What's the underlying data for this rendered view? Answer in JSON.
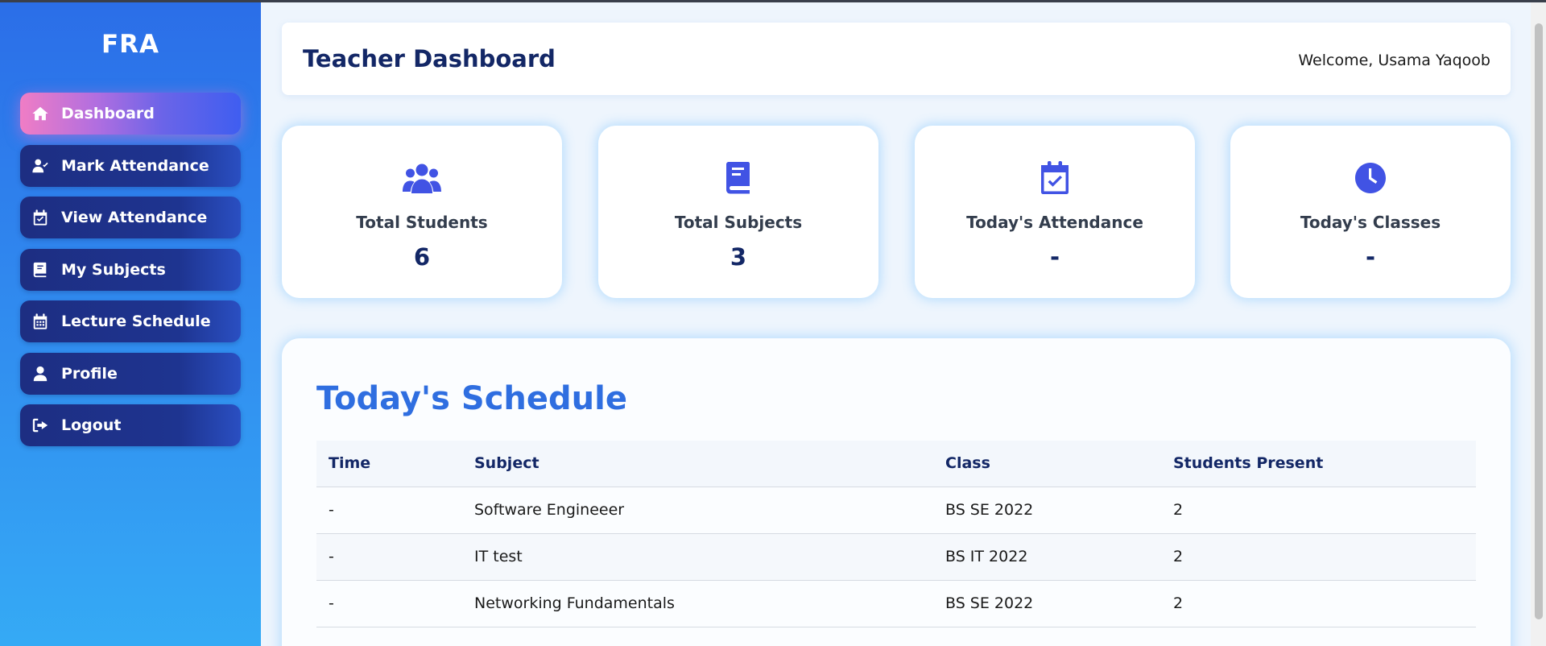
{
  "brand": "FRA",
  "sidebar": {
    "items": [
      {
        "label": "Dashboard",
        "icon": "home-icon",
        "active": true
      },
      {
        "label": "Mark Attendance",
        "icon": "user-check-icon",
        "active": false
      },
      {
        "label": "View Attendance",
        "icon": "calendar-check-icon",
        "active": false
      },
      {
        "label": "My Subjects",
        "icon": "book-icon",
        "active": false
      },
      {
        "label": "Lecture Schedule",
        "icon": "calendar-icon",
        "active": false
      },
      {
        "label": "Profile",
        "icon": "user-icon",
        "active": false
      },
      {
        "label": "Logout",
        "icon": "logout-icon",
        "active": false
      }
    ]
  },
  "header": {
    "title": "Teacher Dashboard",
    "welcome": "Welcome, Usama Yaqoob"
  },
  "cards": [
    {
      "label": "Total Students",
      "value": "6",
      "icon": "users-icon"
    },
    {
      "label": "Total Subjects",
      "value": "3",
      "icon": "book-icon"
    },
    {
      "label": "Today's Attendance",
      "value": "-",
      "icon": "calendar-check-icon"
    },
    {
      "label": "Today's Classes",
      "value": "-",
      "icon": "clock-icon"
    }
  ],
  "schedule": {
    "title": "Today's Schedule",
    "columns": [
      "Time",
      "Subject",
      "Class",
      "Students Present"
    ],
    "rows": [
      {
        "time": "-",
        "subject": "Software Engineeer",
        "class": "BS SE 2022",
        "present": "2"
      },
      {
        "time": "-",
        "subject": "IT test",
        "class": "BS IT 2022",
        "present": "2"
      },
      {
        "time": "-",
        "subject": "Networking Fundamentals",
        "class": "BS SE 2022",
        "present": "2"
      }
    ]
  },
  "colors": {
    "accent": "#4153e4",
    "title": "#132766",
    "schedule_title": "#2f6ee0",
    "sidebar_top": "#2b6ee8",
    "sidebar_bottom": "#35aaf5"
  }
}
